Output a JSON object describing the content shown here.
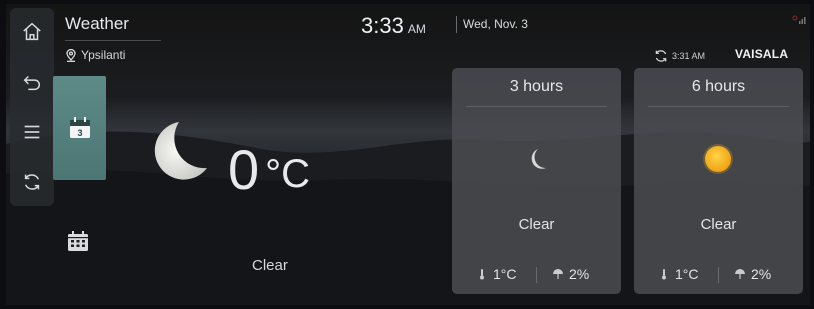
{
  "header": {
    "title": "Weather",
    "location": "Ypsilanti",
    "time": "3:33",
    "ampm": "AM",
    "date": "Wed, Nov. 3",
    "updated_time": "3:31 AM",
    "provider": "VAISALA"
  },
  "rail": {
    "buttons": [
      "home-icon",
      "back-icon",
      "menu-icon",
      "refresh-icon"
    ]
  },
  "calendar": {
    "day_number": "3"
  },
  "current": {
    "temperature": "0",
    "unit": "°C",
    "condition": "Clear",
    "icon": "moon-icon"
  },
  "forecast": [
    {
      "label": "3 hours",
      "condition": "Clear",
      "temp": "1°C",
      "precip": "2%",
      "icon": "moon-icon"
    },
    {
      "label": "6 hours",
      "condition": "Clear",
      "temp": "1°C",
      "precip": "2%",
      "icon": "sun-icon"
    }
  ],
  "colors": {
    "accent_tile": "#5a8785",
    "card_bg": "#4a4c50",
    "sun": "#f5b31a"
  }
}
